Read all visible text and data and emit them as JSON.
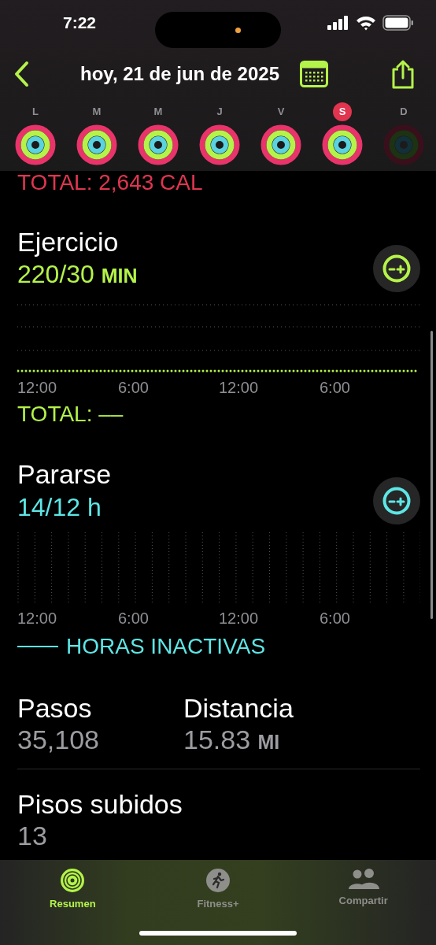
{
  "status_bar": {
    "time": "7:22"
  },
  "nav": {
    "title": "hoy, 21 de jun de 2025"
  },
  "week": [
    {
      "label": "L",
      "selected": false,
      "closed": true
    },
    {
      "label": "M",
      "selected": false,
      "closed": true
    },
    {
      "label": "M",
      "selected": false,
      "closed": true
    },
    {
      "label": "J",
      "selected": false,
      "closed": true
    },
    {
      "label": "V",
      "selected": false,
      "closed": true
    },
    {
      "label": "S",
      "selected": true,
      "closed": true
    },
    {
      "label": "D",
      "selected": false,
      "closed": false
    }
  ],
  "move": {
    "total": "TOTAL: 2,643 CAL"
  },
  "exercise": {
    "title": "Ejercicio",
    "value": "220/30",
    "unit": "MIN",
    "axis": [
      "12:00",
      "6:00",
      "12:00",
      "6:00"
    ],
    "total": "TOTAL: ––"
  },
  "stand": {
    "title": "Pararse",
    "value": "14/12 h",
    "axis": [
      "12:00",
      "6:00",
      "12:00",
      "6:00"
    ],
    "legend": "HORAS INACTIVAS"
  },
  "stats": [
    {
      "title": "Pasos",
      "value": "35,108"
    },
    {
      "title": "Distancia",
      "value": "15.83",
      "unit": "MI"
    }
  ],
  "floors": {
    "title": "Pisos subidos",
    "value": "13"
  },
  "tabs": [
    {
      "label": "Resumen",
      "selected": true,
      "kind": "rings"
    },
    {
      "label": "Fitness+",
      "selected": false,
      "kind": "runner"
    },
    {
      "label": "Compartir",
      "selected": false,
      "kind": "people"
    }
  ]
}
